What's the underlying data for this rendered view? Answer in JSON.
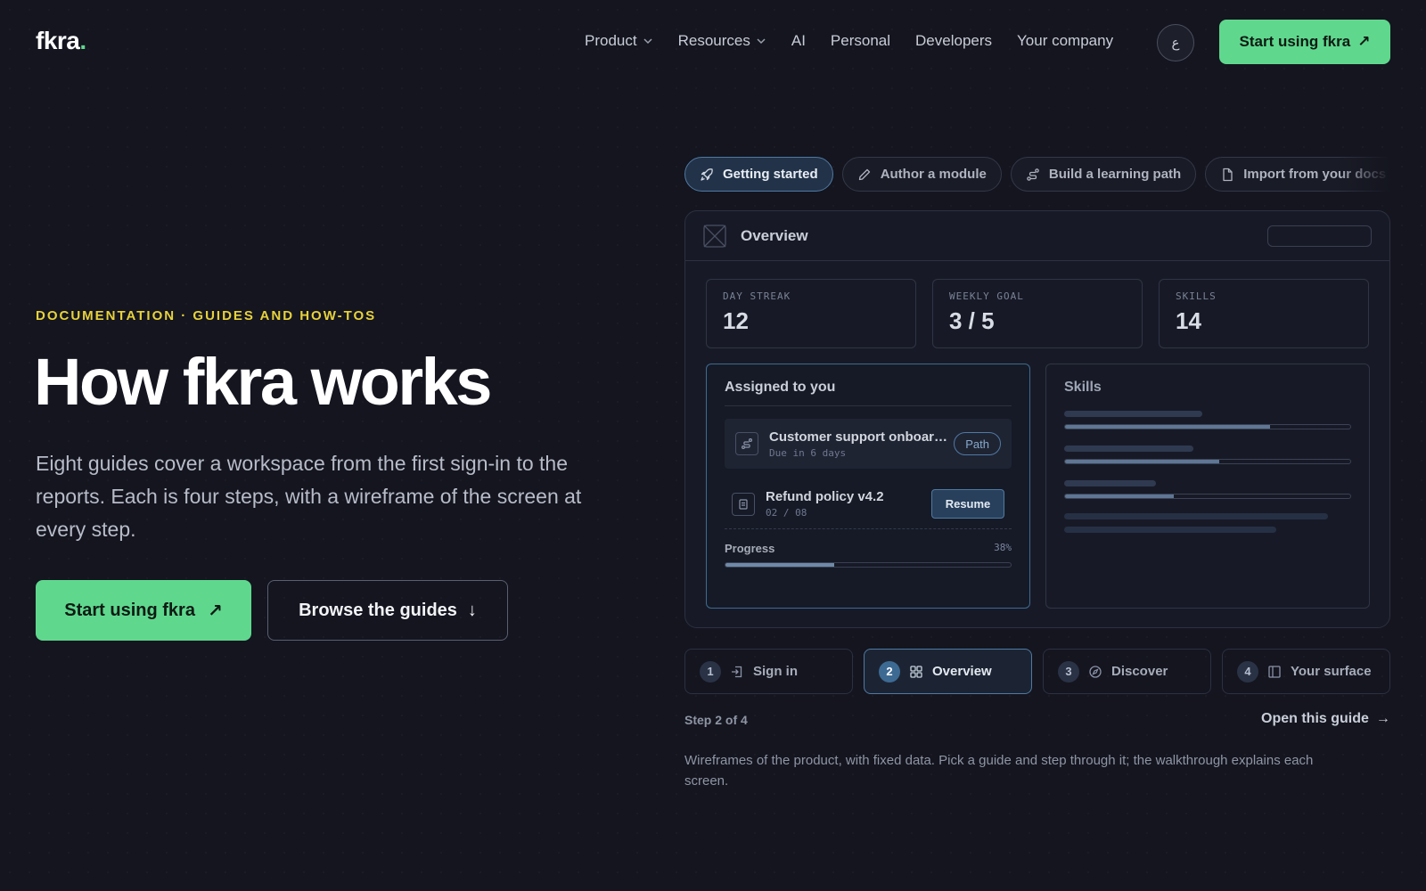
{
  "nav": {
    "logo": "fkra",
    "logo_dot": ".",
    "links": [
      "Product",
      "Resources",
      "AI",
      "Personal",
      "Developers",
      "Your company"
    ],
    "lang_label": "ع",
    "cta_label": "Start using fkra",
    "cta_arrow": "↗"
  },
  "hero": {
    "eyebrow": "DOCUMENTATION · GUIDES AND HOW-TOS",
    "title": "How fkra works",
    "description": "Eight guides cover a workspace from the first sign-in to the reports. Each is four steps, with a wireframe of the screen at every step.",
    "primary_label": "Start using fkra",
    "primary_arrow": "↗",
    "secondary_label": "Browse the guides",
    "secondary_arrow": "↓"
  },
  "guide_tabs": [
    {
      "label": "Getting started",
      "icon": "rocket-icon",
      "active": true
    },
    {
      "label": "Author a module",
      "icon": "pencil-icon",
      "active": false
    },
    {
      "label": "Build a learning path",
      "icon": "route-icon",
      "active": false
    },
    {
      "label": "Import from your docs",
      "icon": "file-import-icon",
      "active": false
    }
  ],
  "panel": {
    "title": "Overview",
    "stats": [
      {
        "label": "DAY STREAK",
        "value": "12"
      },
      {
        "label": "WEEKLY GOAL",
        "value": "3 / 5"
      },
      {
        "label": "SKILLS",
        "value": "14"
      }
    ],
    "assigned": {
      "title": "Assigned to you",
      "item1_title": "Customer support onboarding",
      "item1_sub": "Due in 6 days",
      "item1_badge": "Path",
      "item2_title": "Refund policy v4.2",
      "item2_sub": "02 / 08",
      "item2_button": "Resume",
      "progress_label": "Progress",
      "progress_value": "38%",
      "progress_fraction": 0.38
    },
    "skills": {
      "title": "Skills",
      "levels": [
        0.72,
        0.54,
        0.38
      ]
    }
  },
  "steps": [
    {
      "num": "1",
      "label": "Sign in",
      "icon": "sign-in-icon",
      "active": false
    },
    {
      "num": "2",
      "label": "Overview",
      "icon": "grid-icon",
      "active": true
    },
    {
      "num": "3",
      "label": "Discover",
      "icon": "compass-icon",
      "active": false
    },
    {
      "num": "4",
      "label": "Your surface",
      "icon": "layout-icon",
      "active": false
    }
  ],
  "footer": {
    "step_count": "Step 2 of 4",
    "open_guide": "Open this guide",
    "open_arrow": "→",
    "note": "Wireframes of the product, with fixed data. Pick a guide and step through it; the walkthrough explains each screen."
  },
  "colors": {
    "accent_green": "#5fd88e",
    "eyebrow_yellow": "#e8d23a",
    "active_blue": "#4f7aa3",
    "background": "#14151f"
  }
}
